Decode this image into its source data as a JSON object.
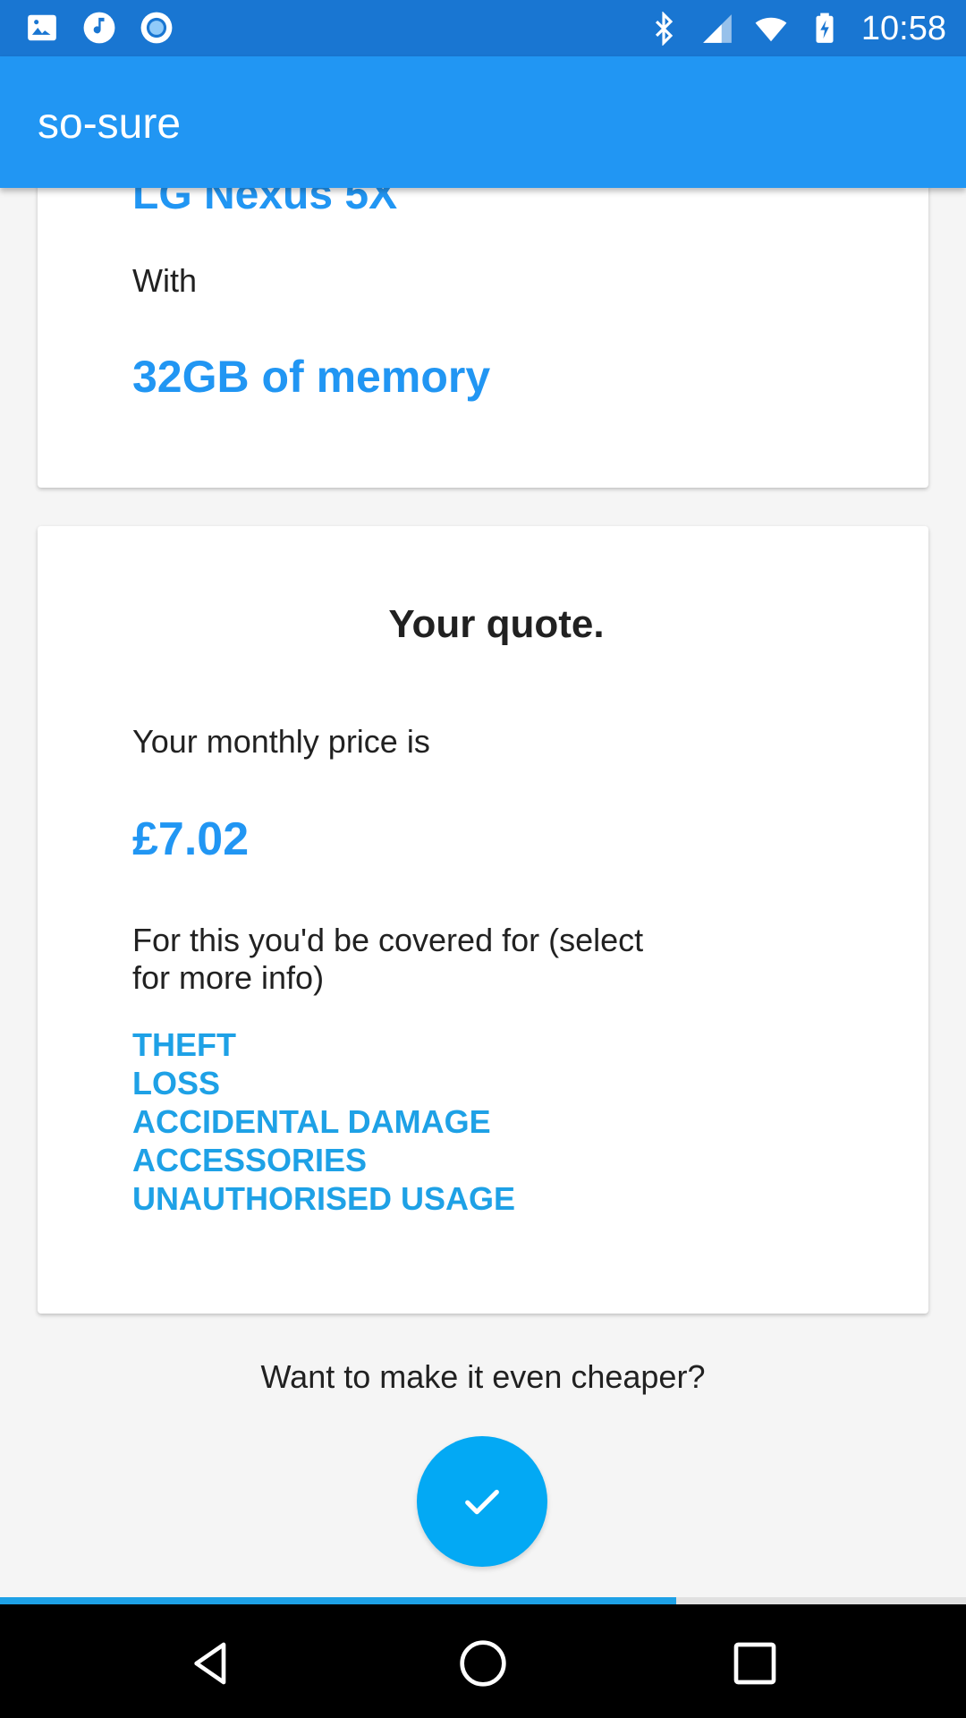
{
  "status_bar": {
    "time": "10:58",
    "left_icons": [
      "image-icon",
      "music-icon",
      "circle-app-icon"
    ],
    "right_icons": [
      "bluetooth-icon",
      "signal-icon",
      "wifi-icon",
      "battery-charging-icon"
    ]
  },
  "app_bar": {
    "title": "so-sure"
  },
  "device_card": {
    "device_name": "LG Nexus 5X",
    "with_label": "With",
    "memory": "32GB of memory"
  },
  "quote_card": {
    "title": "Your quote.",
    "monthly_label": "Your monthly price is",
    "price": "£7.02",
    "covered_label": "For this you'd be covered for (select for more info)",
    "cover_items": [
      "THEFT",
      "LOSS",
      "ACCIDENTAL DAMAGE",
      "ACCESSORIES",
      "UNAUTHORISED USAGE"
    ]
  },
  "cheaper_prompt": "Want to make it even cheaper?",
  "fab_icon": "check-icon",
  "progress": {
    "fraction": 0.7
  },
  "nav": {
    "icons": [
      "back-icon",
      "home-icon",
      "recents-icon"
    ]
  },
  "colors": {
    "status_bar": "#1976d2",
    "app_bar": "#2196f3",
    "accent": "#2196f3",
    "cover_item": "#1ea1e6",
    "fab": "#03a9f4"
  }
}
